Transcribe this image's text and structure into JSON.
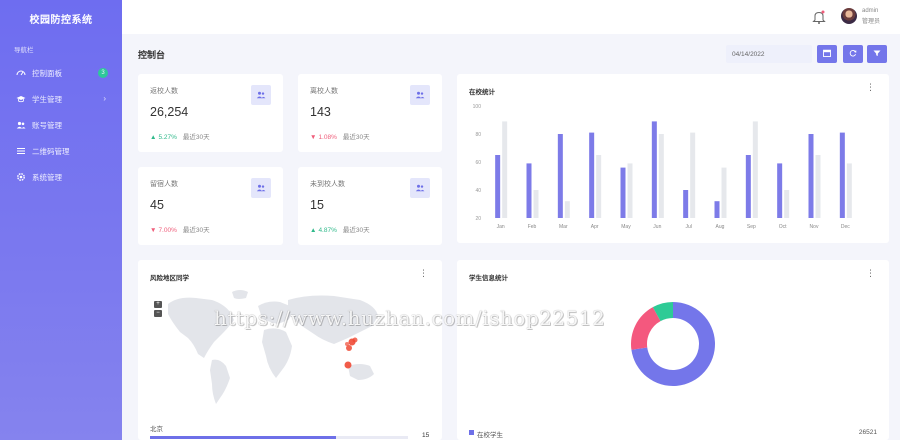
{
  "app": {
    "title": "校园防控系统"
  },
  "sidebar": {
    "heading": "导航栏",
    "items": [
      {
        "label": "控制面板",
        "icon": "dashboard-icon",
        "badge": "3"
      },
      {
        "label": "学生管理",
        "icon": "graduation-cap-icon",
        "chevron": "›"
      },
      {
        "label": "账号管理",
        "icon": "users-icon"
      },
      {
        "label": "二维码管理",
        "icon": "list-icon"
      },
      {
        "label": "系统管理",
        "icon": "gear-icon"
      }
    ]
  },
  "topbar": {
    "user_name": "admin",
    "user_role": "管理员",
    "icons": [
      "bell-icon",
      "avatar"
    ]
  },
  "page": {
    "title": "控制台",
    "date_value": "04/14/2022",
    "buttons": [
      "calendar-icon",
      "refresh-icon",
      "filter-icon"
    ]
  },
  "stats": [
    {
      "label": "返校人数",
      "value": "26,254",
      "trend": "5.27%",
      "direction": "up",
      "period": "最近30天",
      "icon": "users-icon"
    },
    {
      "label": "离校人数",
      "value": "143",
      "trend": "1.08%",
      "direction": "down",
      "period": "最近30天",
      "icon": "users-icon"
    },
    {
      "label": "留宿人数",
      "value": "45",
      "trend": "7.00%",
      "direction": "down",
      "period": "最近30天",
      "icon": "users-icon"
    },
    {
      "label": "未到校人数",
      "value": "15",
      "trend": "4.87%",
      "direction": "up",
      "period": "最近30天",
      "icon": "users-icon"
    }
  ],
  "colors": {
    "accent": "#7476ea",
    "up": "#2fb98a",
    "down": "#ef5d7a",
    "bar_primary": "#7d7be8",
    "bar_secondary": "#e6e8ec",
    "donut": [
      "#7476ea",
      "#f4587e",
      "#2ecb96"
    ]
  },
  "chart_data": [
    {
      "type": "bar",
      "title": "在校统计",
      "categories": [
        "Jan",
        "Feb",
        "Mar",
        "Apr",
        "May",
        "Jun",
        "Jul",
        "Aug",
        "Sep",
        "Oct",
        "Nov",
        "Dec"
      ],
      "series": [
        {
          "values": [
            65,
            59,
            80,
            81,
            56,
            89,
            40,
            32,
            65,
            59,
            80,
            81
          ]
        },
        {
          "values": [
            89,
            40,
            32,
            65,
            59,
            80,
            81,
            56,
            89,
            40,
            65,
            59
          ]
        }
      ],
      "y_ticks": [
        "100",
        "80",
        "60",
        "40",
        "20"
      ],
      "ylim": [
        20,
        100
      ],
      "grid": false,
      "legend": "none"
    },
    {
      "type": "pie",
      "title": "学生信息统计",
      "style": "donut",
      "slices": [
        {
          "name": "在校学生",
          "value": 26521
        },
        {
          "value": 7000
        },
        {
          "value": 2900
        }
      ],
      "legend": "bottom"
    }
  ],
  "map": {
    "title": "风险地区同学",
    "zoom_in": "+",
    "zoom_out": "−",
    "region": {
      "name": "北京",
      "value": "15",
      "fill": 0.72
    },
    "hotspots": 5
  },
  "donut_legend": {
    "label": "在校学生",
    "value": "26521"
  },
  "watermark": "https://www.huzhan.com/ishop22512"
}
